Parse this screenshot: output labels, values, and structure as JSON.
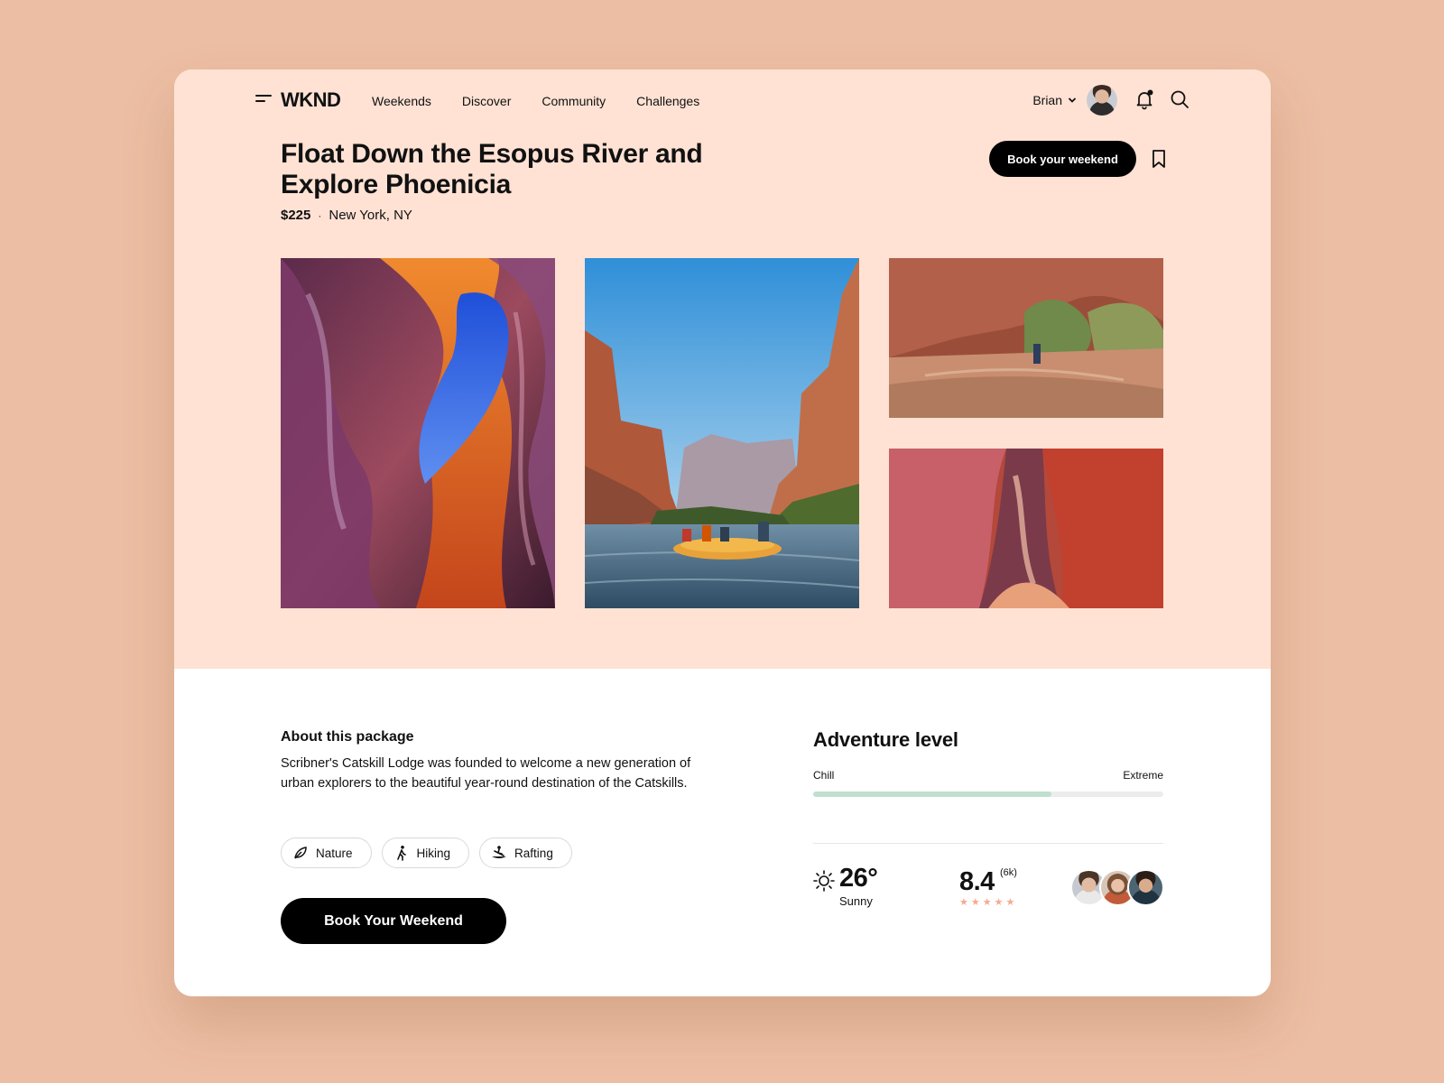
{
  "nav": {
    "logo": "WKND",
    "links": [
      "Weekends",
      "Discover",
      "Community",
      "Challenges"
    ],
    "user_name": "Brian"
  },
  "listing": {
    "title": "Float Down the Esopus River and Explore Phoenicia",
    "price": "$225",
    "separator": "·",
    "location": "New York, NY",
    "book_button_top": "Book your weekend"
  },
  "about": {
    "heading": "About this package",
    "text": "Scribner's Catskill Lodge was founded to welcome a new generation of urban explorers to the beautiful year-round destination of the Catskills.",
    "tags": [
      {
        "label": "Nature",
        "icon": "leaf-icon"
      },
      {
        "label": "Hiking",
        "icon": "hiker-icon"
      },
      {
        "label": "Rafting",
        "icon": "rafting-icon"
      }
    ],
    "book_button_bottom": "Book Your Weekend"
  },
  "adventure": {
    "heading": "Adventure level",
    "min_label": "Chill",
    "max_label": "Extreme",
    "level_fraction": 0.68
  },
  "weather": {
    "temperature": "26°",
    "condition": "Sunny",
    "icon": "sun-icon"
  },
  "rating": {
    "score": "8.4",
    "count": "(6k)",
    "stars": 5
  },
  "colors": {
    "page_background": "#ecbea3",
    "hero_background": "#ffe2d4",
    "accent_progress": "#bfe0cf",
    "star_color": "#f5a98f",
    "button": "#000000"
  }
}
